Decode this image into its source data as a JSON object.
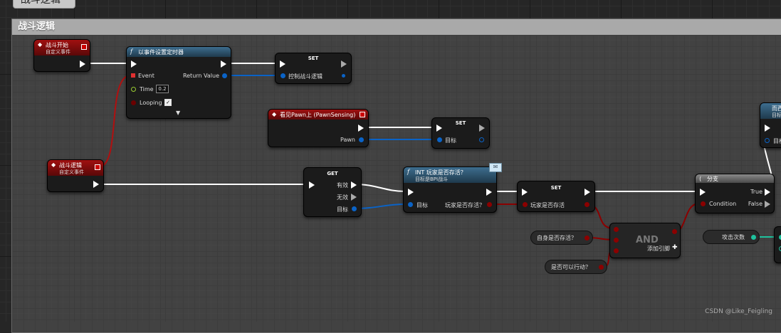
{
  "top_tab": {
    "title": "战斗逻辑"
  },
  "comment": {
    "title": "战斗逻辑"
  },
  "nodes": {
    "battle_start": {
      "title": "战斗开始",
      "subtitle": "自定义事件"
    },
    "set_timer": {
      "title": "以事件设置定时器",
      "pin_event": "Event",
      "pin_return": "Return Value",
      "pin_time": "Time",
      "time_value": "0.2",
      "pin_looping": "Looping"
    },
    "set_control": {
      "title": "SET",
      "pin_var": "控制战斗逻辑"
    },
    "see_pawn": {
      "title": "看见Pawn上 (PawnSensing)",
      "pin_pawn": "Pawn"
    },
    "set_target": {
      "title": "SET",
      "pin_target": "目标"
    },
    "battle_logic": {
      "title": "战斗逻辑",
      "subtitle": "自定义事件"
    },
    "get": {
      "title": "GET",
      "pin_valid": "有效",
      "pin_invalid": "无效",
      "pin_target": "目标"
    },
    "player_alive": {
      "title": "INT 玩家是否存活？",
      "subtitle": "目标是BPI战斗",
      "pin_target": "目标",
      "pin_out": "玩家是否存活？"
    },
    "set_alive": {
      "title": "SET",
      "pin_var": "玩家是否存活"
    },
    "branch": {
      "title": "分支",
      "pin_condition": "Condition",
      "pin_true": "True",
      "pin_false": "False"
    },
    "and": {
      "title": "AND",
      "add_pin": "添加引脚"
    },
    "var_self_alive": {
      "label": "自身是否存活？"
    },
    "var_can_act": {
      "label": "是否可以行动？"
    },
    "var_attack_count": {
      "label": "攻击次数"
    },
    "right_clip": {
      "title": "而西",
      "pin_target": "目标"
    }
  },
  "watermark": "CSDN @Like_Feigling",
  "colors": {
    "exec": "#ffffff",
    "object": "#0088ee",
    "bool": "#8b0000",
    "int": "#1ec29e"
  }
}
